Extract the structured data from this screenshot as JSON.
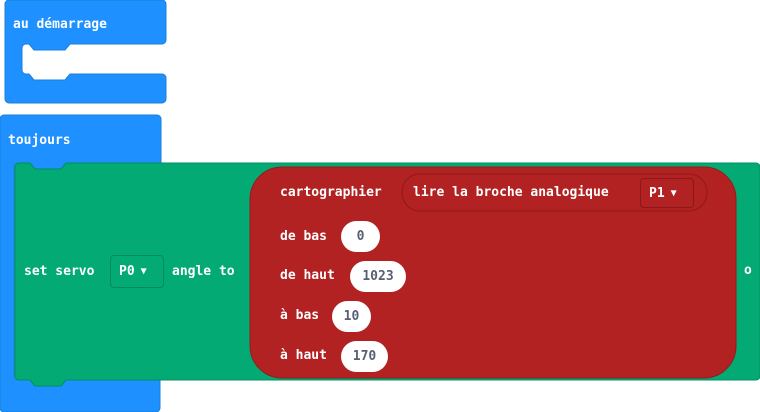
{
  "on_start": {
    "label": "au démarrage"
  },
  "forever": {
    "label": "toujours"
  },
  "servo": {
    "prefix": "set servo",
    "pin": "P0",
    "suffix": "angle to",
    "tail": "o"
  },
  "map": {
    "label": "cartographier",
    "read_label": "lire la broche analogique",
    "read_pin": "P1",
    "from_low_label": "de bas",
    "from_low": "0",
    "from_high_label": "de haut",
    "from_high": "1023",
    "to_low_label": "à bas",
    "to_low": "10",
    "to_high_label": "à haut",
    "to_high": "170"
  },
  "colors": {
    "basic_block": "#1e90ff",
    "servo_block": "#03aa74",
    "math_block": "#b22222"
  },
  "icons": {
    "dropdown": "triangle-down-icon"
  }
}
